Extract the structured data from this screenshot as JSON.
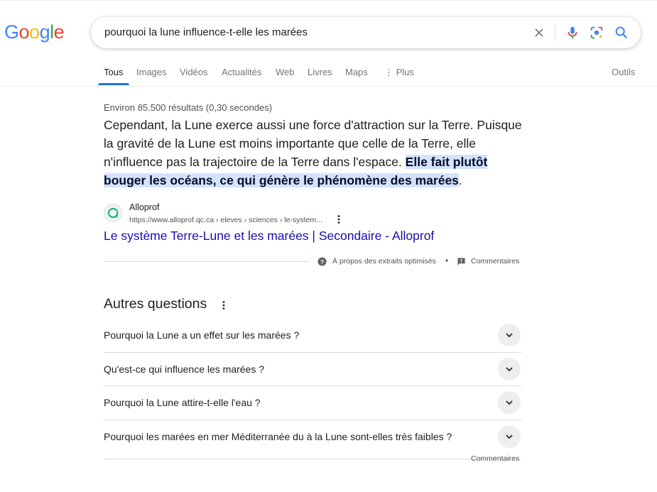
{
  "logo": {
    "letters": [
      "G",
      "o",
      "o",
      "g",
      "l",
      "e"
    ],
    "colors": [
      "#4285F4",
      "#EA4335",
      "#FBBC05",
      "#4285F4",
      "#34A853",
      "#EA4335"
    ]
  },
  "search": {
    "query": "pourquoi la lune influence-t-elle les marées"
  },
  "icons": {
    "clear": "close-icon",
    "mic": "mic-icon",
    "lens": "lens-icon",
    "search": "search-icon"
  },
  "tabs": [
    {
      "label": "Tous",
      "active": true
    },
    {
      "label": "Images"
    },
    {
      "label": "Vidéos"
    },
    {
      "label": "Actualités"
    },
    {
      "label": "Web"
    },
    {
      "label": "Livres"
    },
    {
      "label": "Maps"
    },
    {
      "label": "⋮ Plus"
    }
  ],
  "tools_label": "Outils",
  "results": {
    "stats": "Environ 85.500 résultats (0,30 secondes)",
    "snippet": {
      "plain": "Cependant, la Lune exerce aussi une force d'attraction sur la Terre. Puisque la gravité de la Lune est moins importante que celle de la Terre, elle n'influence pas la trajectoire de la Terre dans l'espace. ",
      "highlight": "Elle fait plutôt bouger les océans, ce qui génère le phénomène des marées",
      "tail": "."
    },
    "source": {
      "name": "Alloprof",
      "url": "https://www.alloprof.qc.ca › eleves › sciences › le-system...",
      "title": "Le système Terre-Lune et les marées | Secondaire - Alloprof",
      "favicon_color": "#1fb57a"
    },
    "feedback": {
      "about": "À propos des extraits optimisés",
      "separator": "•",
      "comments": "Commentaires"
    }
  },
  "paa": {
    "title": "Autres questions",
    "questions": [
      "Pourquoi la Lune a un effet sur les marées ?",
      "Qu'est-ce qui influence les marées ?",
      "Pourquoi la Lune attire-t-elle l'eau ?",
      "Pourquoi les marées en mer Méditerranée du à la Lune sont-elles très faibles ?"
    ],
    "feedback": "Commentaires"
  }
}
